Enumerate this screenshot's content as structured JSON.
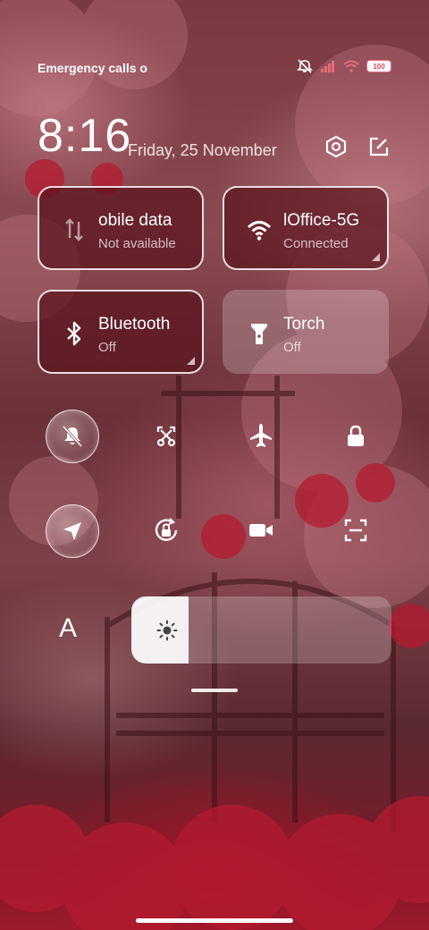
{
  "status_bar": {
    "carrier_text": "Emergency calls o",
    "battery_level": "100",
    "icons": [
      "mute-icon",
      "signal-icon",
      "wifi-icon",
      "battery-icon"
    ]
  },
  "header": {
    "time": "8:16",
    "date": "Friday, 25 November",
    "icons": [
      "settings-icon",
      "edit-icon"
    ]
  },
  "tiles": [
    {
      "name": "mobile-data",
      "label": "obile data",
      "status": "Not available",
      "icon": "data-arrows-icon"
    },
    {
      "name": "wifi",
      "label": "lOffice-5G",
      "status": "Connected",
      "icon": "wifi-icon"
    },
    {
      "name": "bluetooth",
      "label": "Bluetooth",
      "status": "Off",
      "icon": "bluetooth-icon"
    },
    {
      "name": "torch",
      "label": "Torch",
      "status": "Off",
      "icon": "torch-icon"
    }
  ],
  "toggles": [
    {
      "name": "silent",
      "icon": "bell-off-icon"
    },
    {
      "name": "screenshot",
      "icon": "scissors-icon"
    },
    {
      "name": "airplane",
      "icon": "airplane-icon"
    },
    {
      "name": "lock",
      "icon": "lock-icon"
    },
    {
      "name": "location",
      "icon": "location-arrow-icon"
    },
    {
      "name": "rotation-lock",
      "icon": "rotation-lock-icon"
    },
    {
      "name": "screen-record",
      "icon": "video-camera-icon"
    },
    {
      "name": "scanner",
      "icon": "scan-icon"
    }
  ],
  "display": {
    "font_size_label": "A",
    "brightness": 0.22
  }
}
